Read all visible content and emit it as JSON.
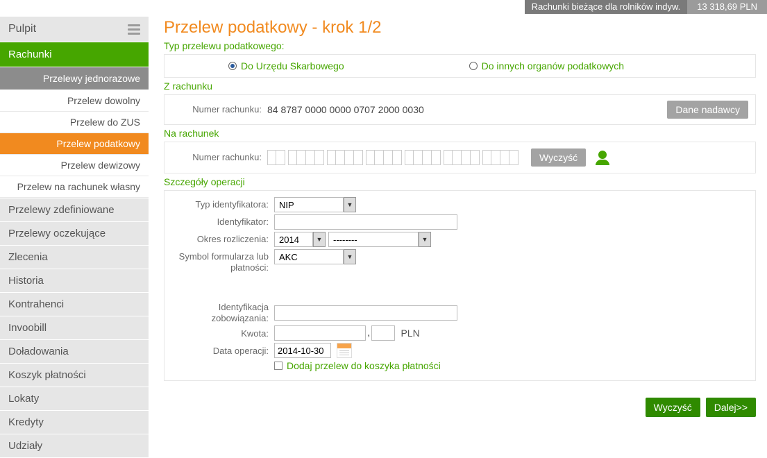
{
  "topbar": {
    "account_label": "Rachunki bieżące dla rolników indyw.",
    "balance": "13 318,69 PLN"
  },
  "sidebar": {
    "dashboard": "Pulpit",
    "accounts": "Rachunki",
    "one_time_transfers": "Przelewy jednorazowe",
    "subitems": {
      "any": "Przelew dowolny",
      "zus": "Przelew do ZUS",
      "tax": "Przelew podatkowy",
      "fx": "Przelew dewizowy",
      "own": "Przelew na rachunek własny"
    },
    "items": [
      "Przelewy zdefiniowane",
      "Przelewy oczekujące",
      "Zlecenia",
      "Historia",
      "Kontrahenci",
      "Invoobill",
      "Doładowania",
      "Koszyk płatności",
      "Lokaty",
      "Kredyty",
      "Udziały"
    ]
  },
  "page": {
    "title": "Przelew podatkowy - krok 1/2",
    "type_label": "Typ przelewu podatkowego:",
    "radio_us": "Do Urzędu Skarbowego",
    "radio_other": "Do innych organów podatkowych",
    "from_label": "Z rachunku",
    "acct_no_label": "Numer rachunku:",
    "acct_no": "84 8787 0000 0000 0707 2000 0030",
    "sender_btn": "Dane nadawcy",
    "to_label": "Na rachunek",
    "clear_btn": "Wyczyść",
    "details_label": "Szczegóły operacji",
    "id_type_label": "Typ identyfikatora:",
    "id_type_value": "NIP",
    "identifier_label": "Identyfikator:",
    "period_label": "Okres rozliczenia:",
    "period_year": "2014",
    "period_part": "--------",
    "form_symbol_label": "Symbol formularza lub płatności:",
    "form_symbol_value": "AKC",
    "obligation_label": "Identyfikacja zobowiązania:",
    "amount_label": "Kwota:",
    "amount_sep": ",",
    "currency": "PLN",
    "date_label": "Data operacji:",
    "date_value": "2014-10-30",
    "basket_label": "Dodaj przelew do koszyka płatności",
    "footer_clear": "Wyczyść",
    "footer_next": "Dalej>>"
  }
}
